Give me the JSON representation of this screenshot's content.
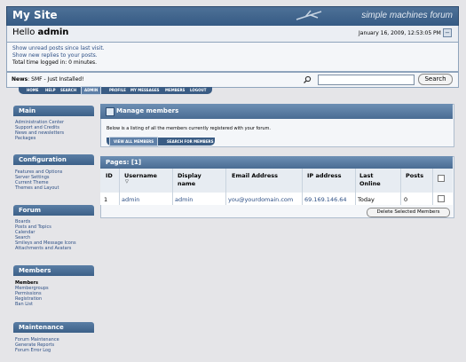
{
  "header": {
    "site_title": "My Site",
    "logo_text": "simple machines forum"
  },
  "greeting": {
    "prefix": "Hello ",
    "user": "admin",
    "datetime": "January 16, 2009, 12:53:05 PM",
    "collapse": "−"
  },
  "info": {
    "unread": "Show unread posts since last visit.",
    "replies": "Show new replies to your posts.",
    "logged": "Total time logged in: 0 minutes."
  },
  "news": {
    "label": "News",
    "text": ": SMF - Just Installed!"
  },
  "search": {
    "button": "Search",
    "placeholder": ""
  },
  "menu": [
    "HOME",
    "HELP",
    "SEARCH",
    "ADMIN",
    "PROFILE",
    "MY MESSAGES",
    "MEMBERS",
    "LOGOUT"
  ],
  "sidebar": {
    "main": {
      "title": "Main",
      "items": [
        "Administration Center",
        "Support and Credits",
        "News and newsletters",
        "Packages"
      ]
    },
    "configuration": {
      "title": "Configuration",
      "items": [
        "Features and Options",
        "Server Settings",
        "Current Theme",
        "Themes and Layout"
      ]
    },
    "forum": {
      "title": "Forum",
      "items": [
        "Boards",
        "Posts and Topics",
        "Calendar",
        "Search",
        "Smileys and Message Icons",
        "Attachments and Avatars"
      ]
    },
    "members": {
      "title": "Members",
      "items": [
        "Members",
        "Membergroups",
        "Permissions",
        "Registration",
        "Ban List"
      ]
    },
    "maintenance": {
      "title": "Maintenance",
      "items": [
        "Forum Maintenance",
        "Generate Reports",
        "Forum Error Log"
      ]
    }
  },
  "manage": {
    "title": "Manage members",
    "description": "Below is a listing of all the members currently registered with your forum.",
    "tabs": [
      "VIEW ALL MEMBERS",
      "SEARCH FOR MEMBERS"
    ]
  },
  "table": {
    "pages": "Pages: [1]",
    "headers": {
      "id": "ID",
      "username": "Username",
      "display1": "Display",
      "display2": "name",
      "email": "Email Address",
      "ip": "IP address",
      "last1": "Last",
      "last2": "Online",
      "posts": "Posts"
    },
    "rows": [
      {
        "id": "1",
        "username": "admin",
        "display": "admin",
        "email": "you@yourdomain.com",
        "ip": "69.169.146.64",
        "last": "Today",
        "posts": "0"
      }
    ],
    "delete_button": "Delete Selected Members"
  }
}
